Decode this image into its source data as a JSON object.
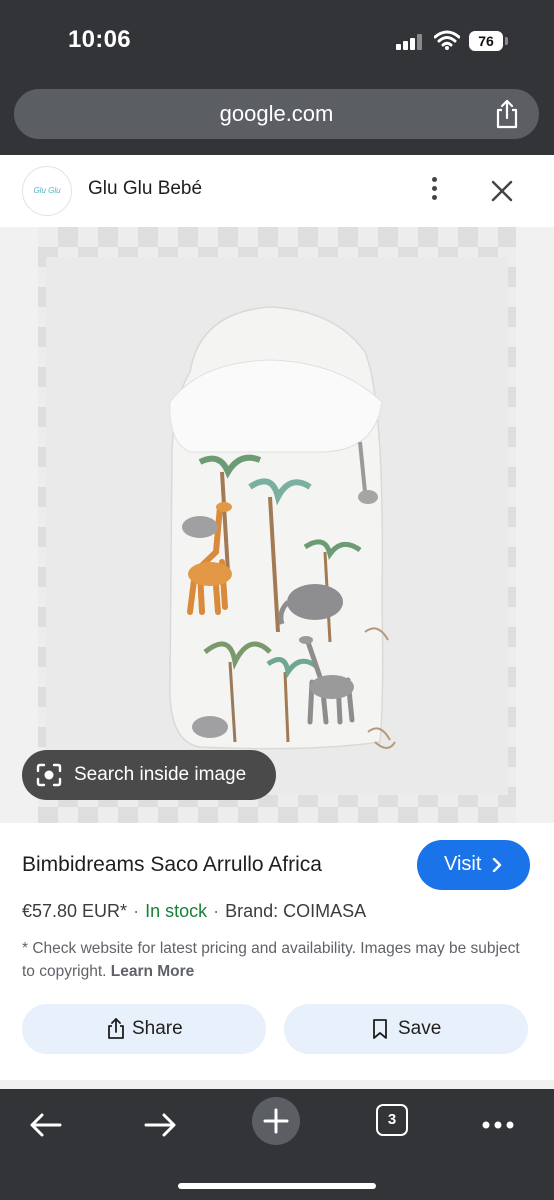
{
  "status_bar": {
    "time": "10:06",
    "battery": "76"
  },
  "browser": {
    "url": "google.com",
    "tab_count": "3"
  },
  "site": {
    "name": "Glu Glu Bebé",
    "logo_text": "Glu Glu"
  },
  "image": {
    "search_inside_label": "Search inside image"
  },
  "product": {
    "title": "Bimbidreams Saco Arrullo Africa",
    "visit_label": "Visit",
    "price": "€57.80 EUR*",
    "stock": "In stock",
    "brand": "Brand: COIMASA",
    "disclaimer": "* Check website for latest pricing and availability. Images may be subject to copyright.",
    "learn_more": "Learn More",
    "share_label": "Share",
    "save_label": "Save"
  },
  "colors": {
    "chrome": "#323437",
    "accent": "#1a73e8",
    "in_stock": "#188038",
    "action_button_bg": "#e8f0fb"
  },
  "icons": {
    "toolbar": [
      "back-arrow-icon",
      "forward-arrow-icon",
      "new-tab-plus-icon",
      "tabs-icon",
      "more-icon"
    ]
  }
}
